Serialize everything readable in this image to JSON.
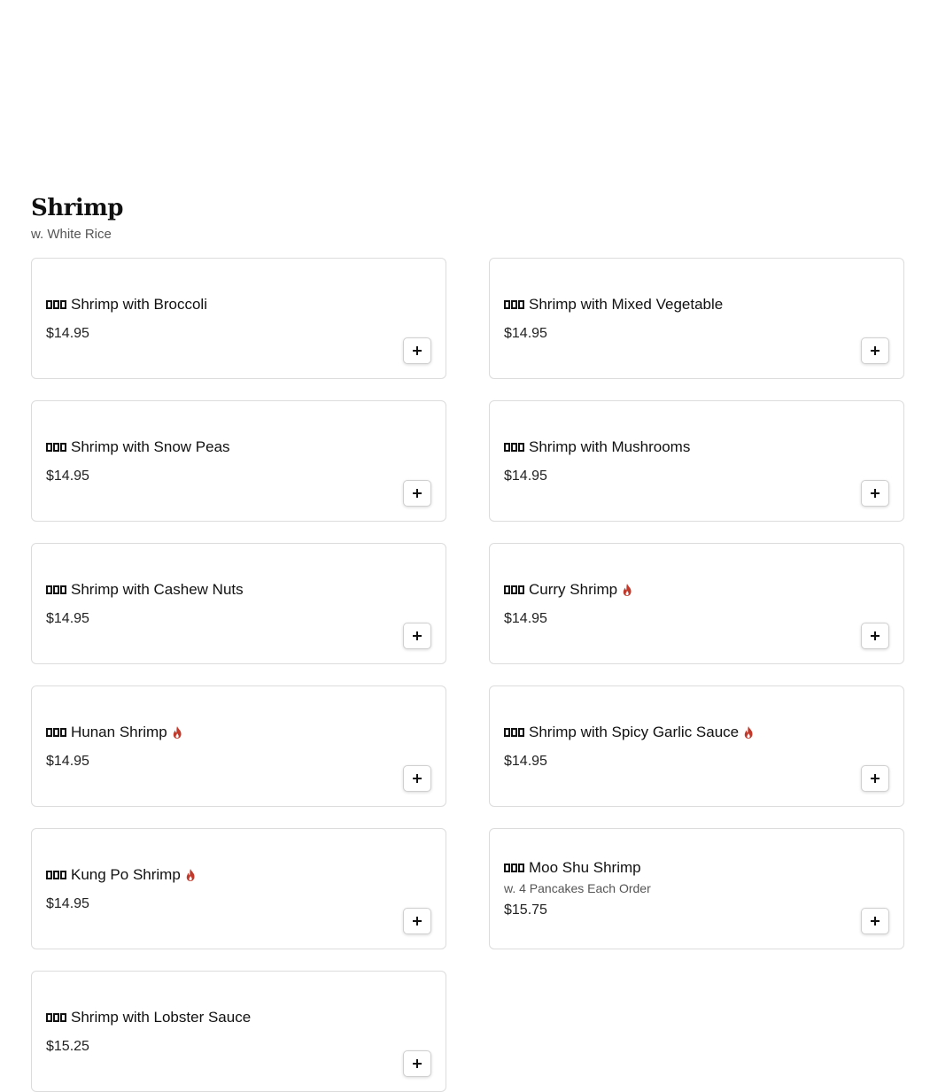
{
  "section": {
    "title": "Shrimp",
    "subtitle": "w. White Rice"
  },
  "colors": {
    "spicy": "#c0392b",
    "border": "#dcdcdc"
  },
  "icons": {
    "spicy": "flame-icon",
    "add": "plus-icon"
  },
  "items": [
    {
      "name": "Shrimp with Broccoli",
      "price": "$14.95",
      "spicy": false,
      "desc": ""
    },
    {
      "name": "Shrimp with Mixed Vegetable",
      "price": "$14.95",
      "spicy": false,
      "desc": ""
    },
    {
      "name": "Shrimp with Snow Peas",
      "price": "$14.95",
      "spicy": false,
      "desc": ""
    },
    {
      "name": "Shrimp with Mushrooms",
      "price": "$14.95",
      "spicy": false,
      "desc": ""
    },
    {
      "name": "Shrimp with Cashew Nuts",
      "price": "$14.95",
      "spicy": false,
      "desc": ""
    },
    {
      "name": "Curry Shrimp",
      "price": "$14.95",
      "spicy": true,
      "desc": ""
    },
    {
      "name": "Hunan Shrimp",
      "price": "$14.95",
      "spicy": true,
      "desc": ""
    },
    {
      "name": "Shrimp with Spicy Garlic Sauce",
      "price": "$14.95",
      "spicy": true,
      "desc": ""
    },
    {
      "name": "Kung Po Shrimp",
      "price": "$14.95",
      "spicy": true,
      "desc": ""
    },
    {
      "name": "Moo Shu Shrimp",
      "price": "$15.75",
      "spicy": false,
      "desc": "w. 4 Pancakes Each Order"
    },
    {
      "name": "Shrimp with Lobster Sauce",
      "price": "$15.25",
      "spicy": false,
      "desc": ""
    }
  ]
}
